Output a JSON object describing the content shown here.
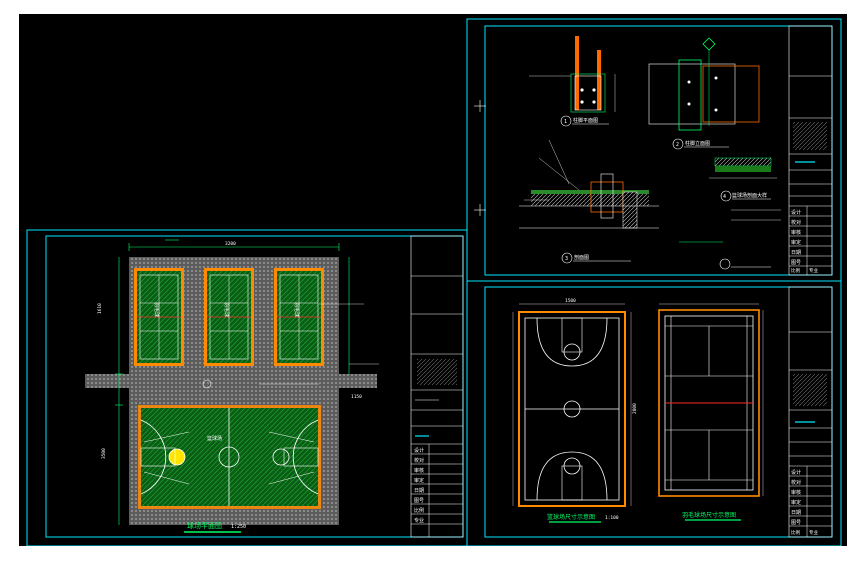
{
  "colors": {
    "background": "#000000",
    "frame": "#00e5ff",
    "court_green": "#0b6b1a",
    "paving": "#6e6e6e",
    "edge_orange": "#ff8a00",
    "line_white": "#ffffff",
    "accent_green": "#00ff66",
    "accent_red": "#ff2a2a",
    "accent_yellow": "#ffe600"
  },
  "sheets": [
    {
      "id": "site-plan",
      "caption": "球场平面图",
      "scale": "1:250",
      "dims": [
        "3200",
        "1610",
        "1150",
        "3500"
      ],
      "labels": [
        "羽毛球",
        "羽毛球",
        "羽毛球",
        "篮球场"
      ],
      "title_block_fields": [
        "设计",
        "校对",
        "审核",
        "审定",
        "日期",
        "图号",
        "比例",
        "专业"
      ]
    },
    {
      "id": "details",
      "captions": [
        "柱脚平面图",
        "柱脚立面图",
        "剖面图",
        "篮球场剖面大样"
      ],
      "numbers": [
        "1",
        "2",
        "3",
        "4"
      ],
      "title_block_fields": [
        "设计",
        "校对",
        "审核",
        "审定",
        "日期",
        "图号",
        "比例",
        "专业"
      ]
    },
    {
      "id": "court-dims",
      "captions": [
        "篮球场尺寸示意图",
        "羽毛球场尺寸示意图"
      ],
      "scale": "1:100",
      "dims": [
        "2800",
        "1500"
      ],
      "title_block_fields": [
        "设计",
        "校对",
        "审核",
        "审定",
        "日期",
        "图号",
        "比例",
        "专业"
      ]
    }
  ]
}
